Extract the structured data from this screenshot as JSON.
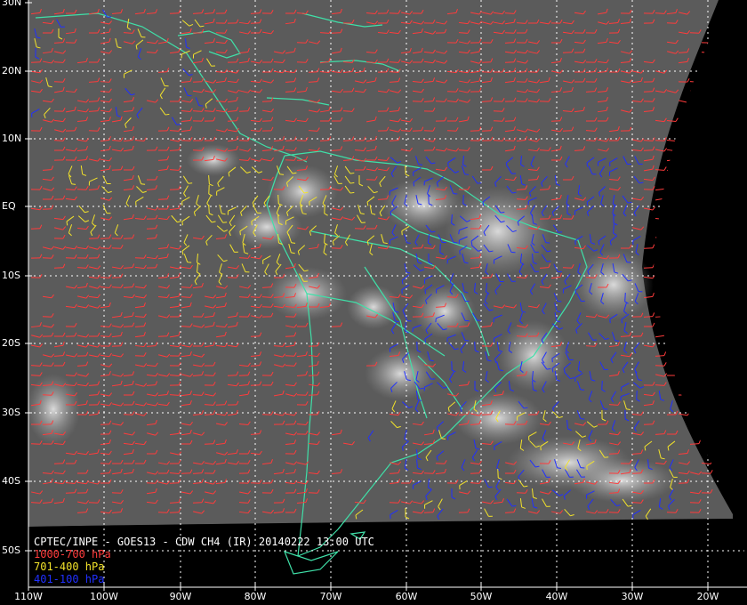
{
  "title": "CPTEC/INPE - GOES13 - CDW CH4 (IR) 20140222 13:00 UTC",
  "legend": [
    {
      "label": "1000-700 hPa",
      "color": "#ff3b3b"
    },
    {
      "label": "701-400 hPa",
      "color": "#f2e22a"
    },
    {
      "label": "401-100 hPa",
      "color": "#2030ff"
    }
  ],
  "coast_color": "#3fe0a8",
  "grid_color": "#ffffff",
  "lat_labels": [
    "30N",
    "20N",
    "10N",
    "EQ",
    "10S",
    "20S",
    "30S",
    "40S",
    "50S"
  ],
  "lon_labels": [
    "110W",
    "100W",
    "90W",
    "80W",
    "70W",
    "60W",
    "50W",
    "40W",
    "30W",
    "20W"
  ]
}
